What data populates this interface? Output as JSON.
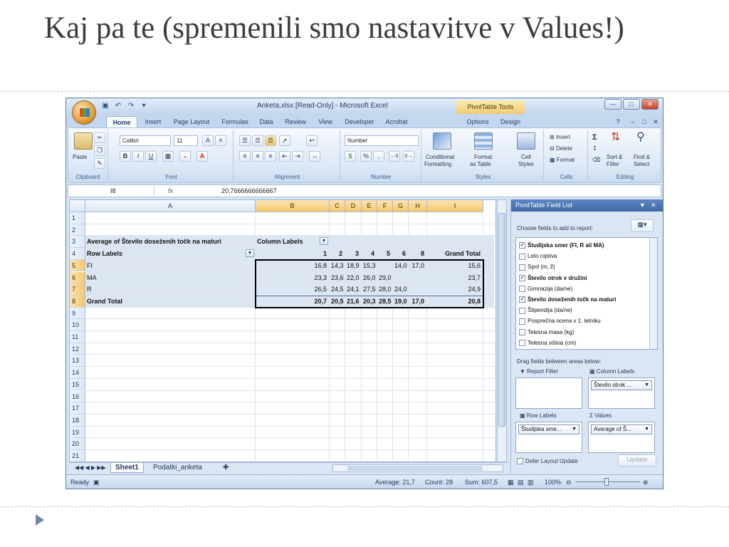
{
  "slide": {
    "title": "Kaj pa te (spremenili smo nastavitve v Values!)"
  },
  "excel": {
    "window_title": "Anketa.xlsx [Read-Only] - Microsoft Excel",
    "context_tools": "PivotTable Tools",
    "tabs": [
      "Home",
      "Insert",
      "Page Layout",
      "Formulas",
      "Data",
      "Review",
      "View",
      "Developer",
      "Acrobat",
      "Options",
      "Design"
    ],
    "active_tab": "Home",
    "ribbon": {
      "clipboard": {
        "label": "Clipboard",
        "paste": "Paste"
      },
      "font": {
        "label": "Font",
        "name": "Calibri",
        "size": "11",
        "bold": "B",
        "italic": "I",
        "underline": "U"
      },
      "alignment": {
        "label": "Alignment"
      },
      "number": {
        "label": "Number",
        "format": "Number",
        "percent": "%",
        "comma": ","
      },
      "styles": {
        "label": "Styles",
        "conditional": "Conditional",
        "conditional2": "Formatting",
        "format_table": "Format",
        "format_table2": "as Table",
        "cell_styles": "Cell",
        "cell_styles2": "Styles"
      },
      "cells": {
        "label": "Cells",
        "insert": "Insert",
        "delete": "Delete",
        "format": "Format"
      },
      "editing": {
        "label": "Editing",
        "sort": "Sort &",
        "sort2": "Filter",
        "find": "Find &",
        "find2": "Select"
      }
    },
    "formula_bar": {
      "name_box": "I8",
      "fx": "fx",
      "value": "20,7666666666667"
    },
    "columns": [
      "A",
      "B",
      "C",
      "D",
      "E",
      "F",
      "G",
      "H",
      "I"
    ],
    "selected_columns": [
      "B",
      "C",
      "D",
      "E",
      "F",
      "G",
      "H",
      "I"
    ],
    "rows": [
      "1",
      "2",
      "3",
      "4",
      "5",
      "6",
      "7",
      "8",
      "9",
      "10",
      "11",
      "12",
      "13",
      "14",
      "15",
      "16",
      "17",
      "18",
      "19",
      "20",
      "21"
    ],
    "selected_rows": [
      "5",
      "6",
      "7",
      "8"
    ],
    "pivot": {
      "header_a3": "Average of Število doseženih točk na maturi",
      "column_labels": "Column Labels",
      "row_labels": "Row Labels",
      "col_keys": [
        "1",
        "2",
        "3",
        "4",
        "5",
        "6",
        "8",
        "Grand Total"
      ],
      "data_rows": [
        {
          "label": "FI",
          "values": [
            "16,8",
            "14,3",
            "18,9",
            "15,3",
            "",
            "14,0",
            "17,0",
            "15,6"
          ]
        },
        {
          "label": "MA",
          "values": [
            "23,3",
            "23,6",
            "22,0",
            "26,0",
            "29,0",
            "",
            "",
            "23,7"
          ]
        },
        {
          "label": "R",
          "values": [
            "26,5",
            "24,5",
            "24,1",
            "27,5",
            "28,0",
            "24,0",
            "",
            "24,9"
          ]
        }
      ],
      "grand_total": {
        "label": "Grand Total",
        "values": [
          "20,7",
          "20,5",
          "21,6",
          "20,3",
          "28,5",
          "19,0",
          "17,0",
          "20,8"
        ]
      }
    },
    "sheet_tabs": [
      "Sheet1",
      "Podatki_anketa"
    ],
    "active_sheet": "Sheet1",
    "status": {
      "ready": "Ready",
      "average": "Average: 21,7",
      "count": "Count: 28",
      "sum": "Sum: 607,5",
      "zoom": "100%"
    },
    "pivot_field_list": {
      "title": "PivotTable Field List",
      "choose_label": "Choose fields to add to report:",
      "fields": [
        {
          "name": "Študijska smer (FI, R ali MA)",
          "checked": true
        },
        {
          "name": "Leto rojstva",
          "checked": false
        },
        {
          "name": "Spol (m, ž)",
          "checked": false
        },
        {
          "name": "Število otrok v družini",
          "checked": true
        },
        {
          "name": "Gimnazija (da/ne)",
          "checked": false
        },
        {
          "name": "Število doseženih točk na maturi",
          "checked": true
        },
        {
          "name": "Štipendija (da/ne)",
          "checked": false
        },
        {
          "name": "Povprečna ocena v 1. letniku",
          "checked": false
        },
        {
          "name": "Telesna masa (kg)",
          "checked": false
        },
        {
          "name": "Telesna višina (cm)",
          "checked": false
        }
      ],
      "drag_label": "Drag fields between areas below:",
      "report_filter": "Report Filter",
      "column_labels": "Column Labels",
      "column_field": "Število otrok ...",
      "row_labels": "Row Labels",
      "values": "Values",
      "row_field": "Študijska sme...",
      "value_field": "Average of Š...",
      "defer": "Defer Layout Update",
      "update": "Update"
    }
  }
}
